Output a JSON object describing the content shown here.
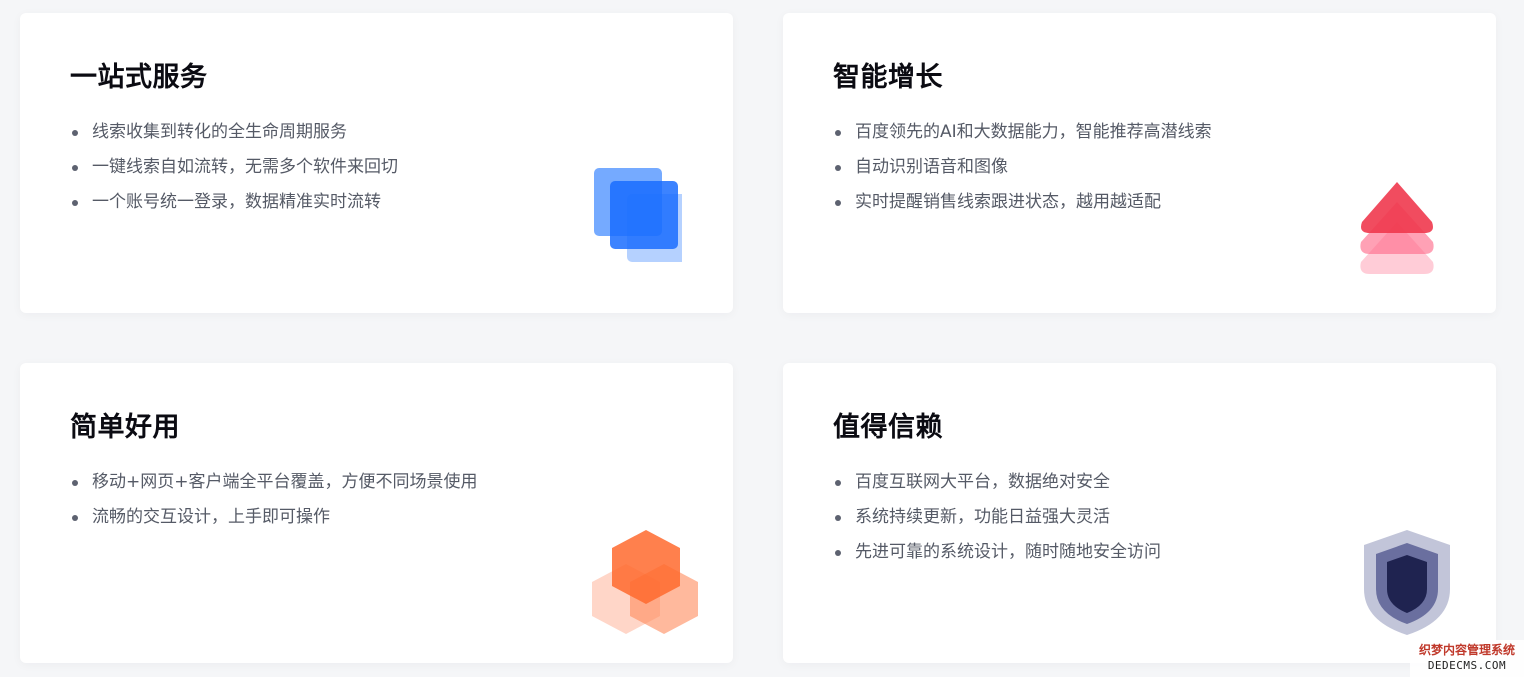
{
  "cards": [
    {
      "title": "一站式服务",
      "icon": "overlapping-squares-icon",
      "accent": "#2b7cff",
      "items": [
        "线索收集到转化的全生命周期服务",
        "一键线索自如流转，无需多个软件来回切",
        "一个账号统一登录，数据精准实时流转"
      ]
    },
    {
      "title": "智能增长",
      "icon": "stacked-arrows-up-icon",
      "accent": "#f0384e",
      "items": [
        "百度领先的AI和大数据能力，智能推荐高潜线索",
        "自动识别语音和图像",
        "实时提醒销售线索跟进状态，越用越适配"
      ]
    },
    {
      "title": "简单好用",
      "icon": "hexagon-cluster-icon",
      "accent": "#ff6a2e",
      "items": [
        "移动+网页+客户端全平台覆盖，方便不同场景使用",
        "流畅的交互设计，上手即可操作"
      ]
    },
    {
      "title": "值得信赖",
      "icon": "shield-icon",
      "accent": "#1f2350",
      "items": [
        "百度互联网大平台，数据绝对安全",
        "系统持续更新，功能日益强大灵活",
        "先进可靠的系统设计，随时随地安全访问"
      ]
    }
  ],
  "watermark": {
    "line1": "织梦内容管理系统",
    "line2": "DEDECMS.COM"
  }
}
